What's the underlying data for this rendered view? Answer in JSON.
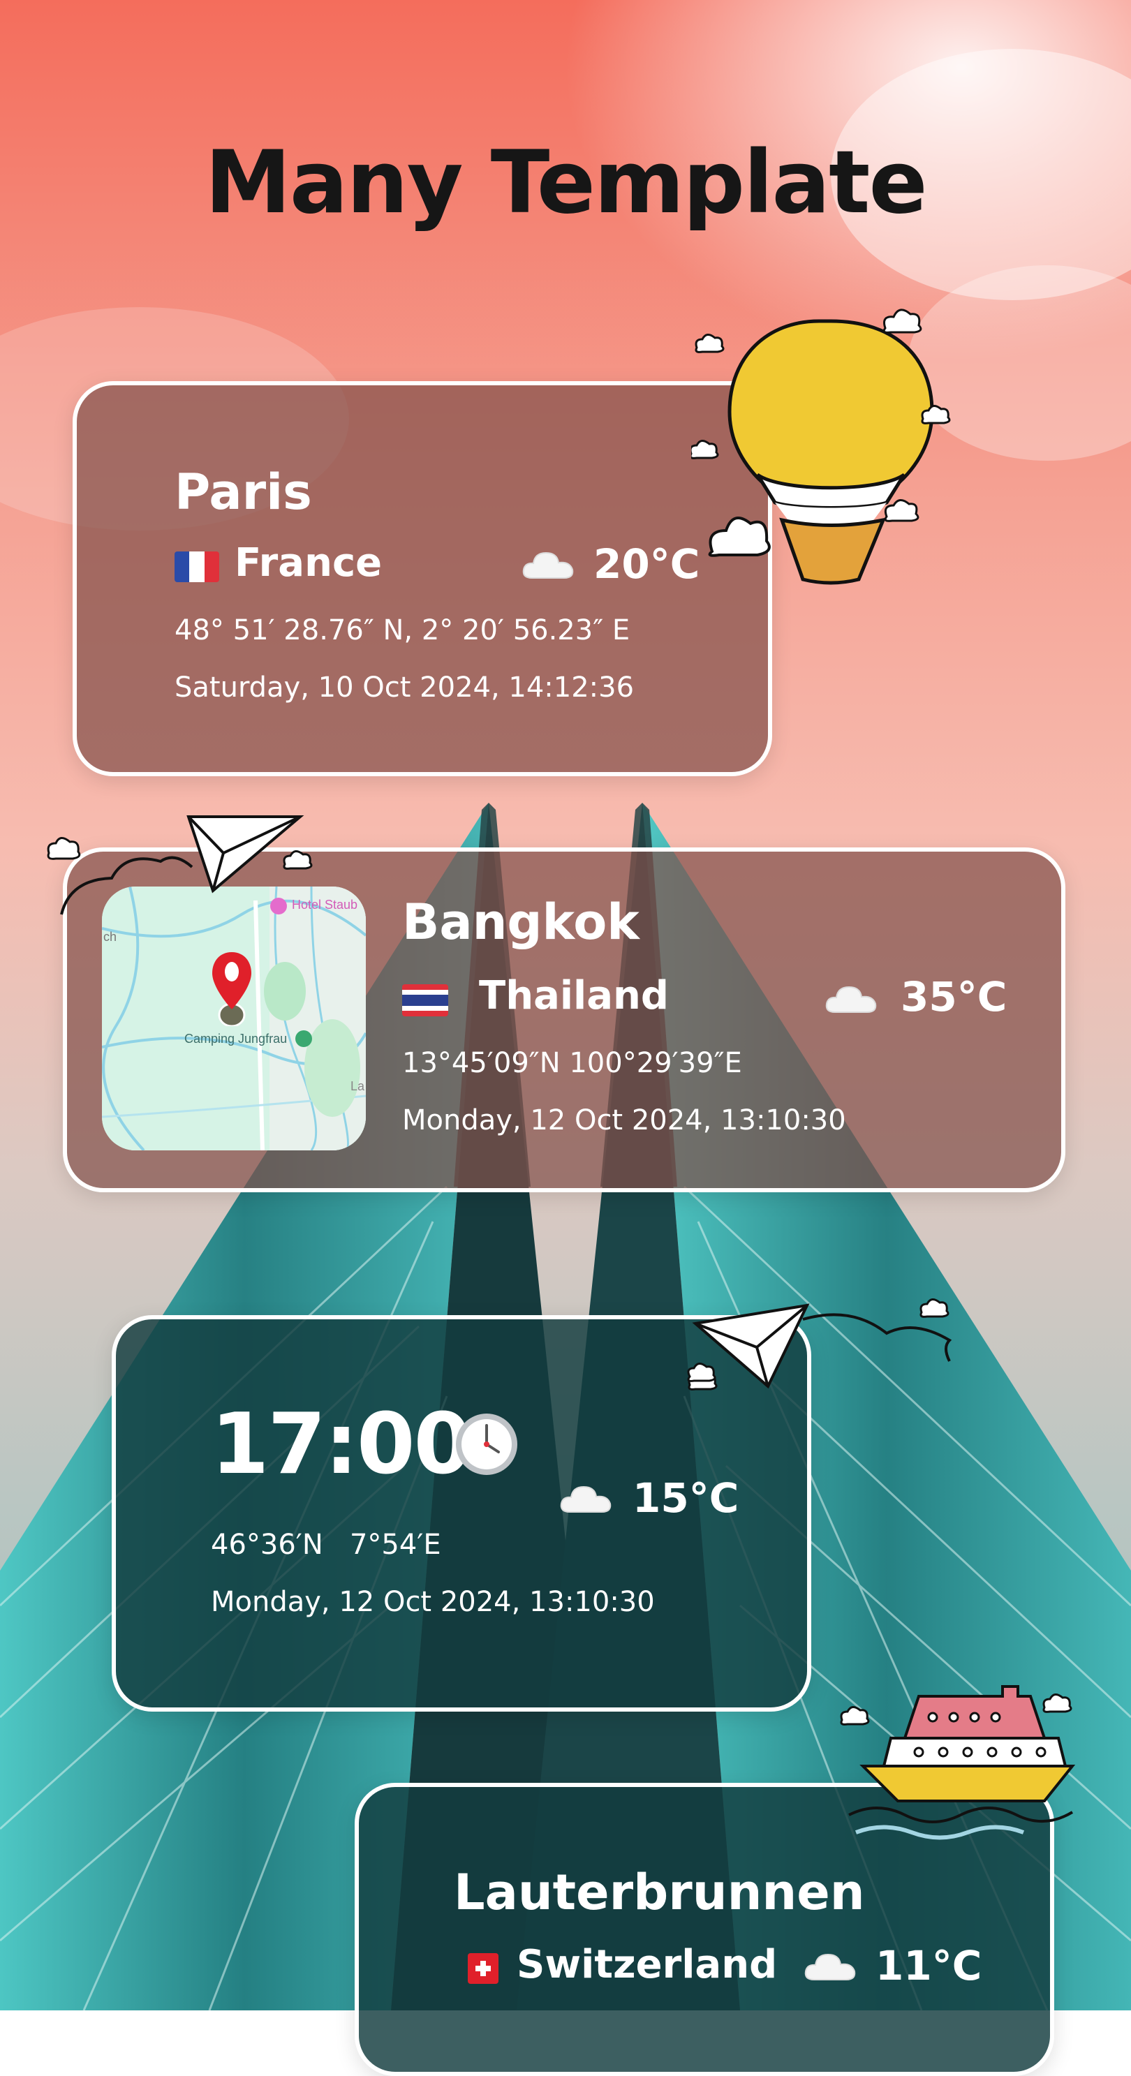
{
  "screen": {
    "headline": "Many Template"
  },
  "cards": {
    "paris": {
      "city": "Paris",
      "country": "France",
      "temperature": "20°C",
      "coordinates": "48° 51′ 28.76″ N, 2° 20′ 56.23″ E",
      "datetime": "Saturday, 10 Oct 2024,  14:12:36",
      "weather_icon": "cloud-icon",
      "flag_icon": "france-flag-icon"
    },
    "bangkok": {
      "city": "Bangkok",
      "country": "Thailand",
      "temperature": "35°C",
      "coordinates": "13°45′09″N 100°29′39″E",
      "datetime": "Monday, 12 Oct 2024,  13:10:30",
      "weather_icon": "cloud-icon",
      "flag_icon": "thailand-flag-icon",
      "map": {
        "label_hotel": "Hotel Staub",
        "label_camping": "Camping Jungfrau",
        "label_edge_left": "ch",
        "label_edge_right": "La",
        "pin_icon": "map-pin-icon"
      }
    },
    "clock": {
      "time": "17:00",
      "temperature": "15°C",
      "coordinates": "46°36′N   7°54′E",
      "datetime": "Monday, 12 Oct 2024,  13:10:30",
      "clock_icon": "clock-icon",
      "weather_icon": "cloud-icon"
    },
    "lauterbrunnen": {
      "city": "Lauterbrunnen",
      "country": "Switzerland",
      "temperature": "11°C",
      "weather_icon": "cloud-icon",
      "flag_icon": "switzerland-flag-icon"
    }
  },
  "decorations": [
    "hot-air-balloon-icon",
    "paper-plane-icon",
    "cruise-ship-icon",
    "small-cloud-icon"
  ],
  "colors": {
    "sky_top": "#f06e5e",
    "sky_mid": "#f8b3a8",
    "card_rose": "#804e48",
    "card_teal": "#123c3e",
    "building_teal": "#2a9aa0",
    "balloon_yellow": "#f0c933",
    "pin_red": "#e0202a"
  }
}
